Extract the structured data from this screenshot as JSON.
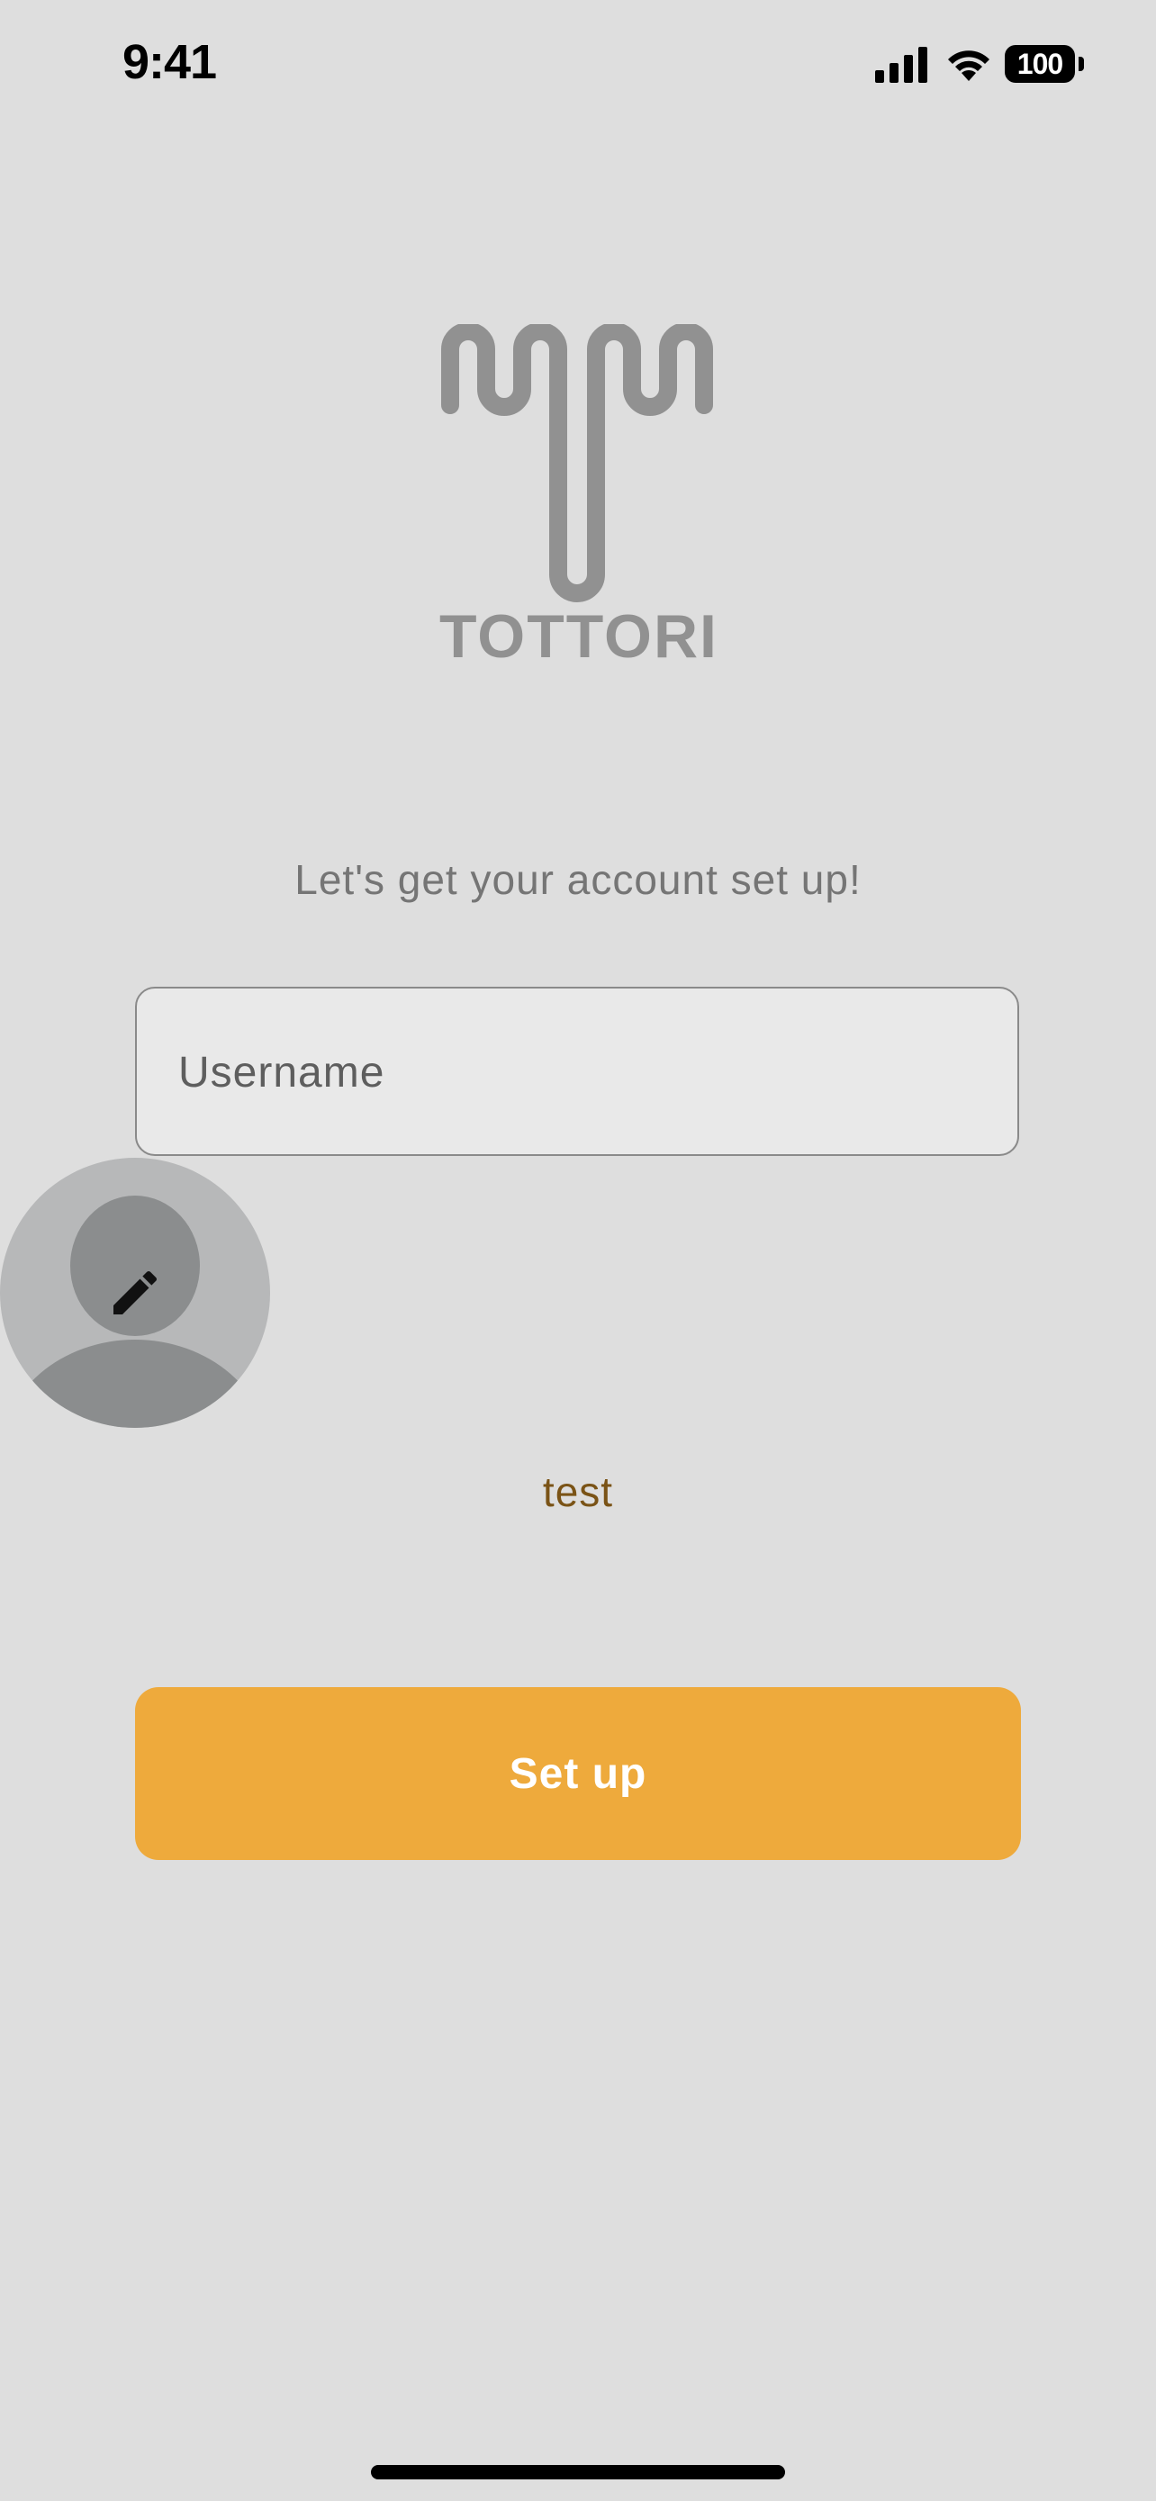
{
  "status_bar": {
    "time": "9:41",
    "battery_level": "100",
    "icons": [
      "signal-icon",
      "wifi-icon",
      "battery-icon"
    ]
  },
  "logo": {
    "text": "TOTTORI",
    "color": "#919191"
  },
  "headline": "Let's get your account set up!",
  "username_field": {
    "placeholder": "Username",
    "value": ""
  },
  "avatar": {
    "icon": "edit-icon"
  },
  "test_label": "test",
  "setup_button": {
    "label": "Set up",
    "color": "#eeaa3c"
  },
  "colors": {
    "background": "#dedede",
    "accent": "#eeaa3c",
    "test_text": "#7a5316"
  }
}
